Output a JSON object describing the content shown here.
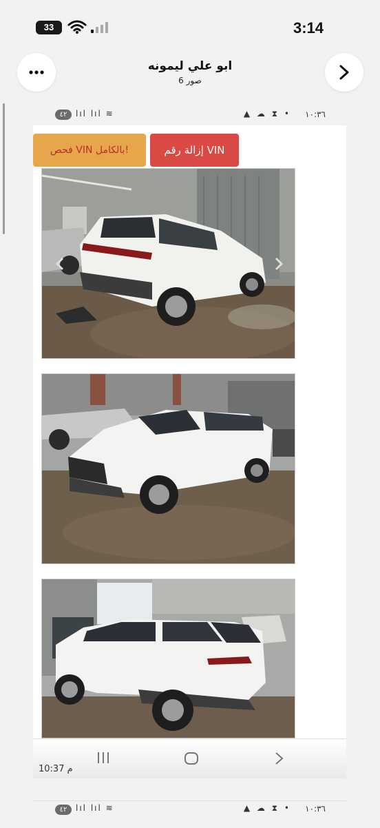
{
  "ios_status": {
    "time": "3:14",
    "battery": "33"
  },
  "header": {
    "title": "ابو علي ليمونه",
    "subtitle": "6 صور"
  },
  "embedded_status": {
    "time": "١٠:٣٦",
    "badge": "٤٢",
    "icons": "▲ ☁ ⧗ •",
    "signal": "lıl lıl ≋"
  },
  "buttons": {
    "vin_full_check": "فحص VIN بالكامل!",
    "vin_remove": "إزالة رقم VIN"
  },
  "photos": [
    {
      "alt": "white SUV rear three-quarter view"
    },
    {
      "alt": "white SUV front three-quarter view"
    },
    {
      "alt": "white SUV rear side view"
    }
  ],
  "bottom_nav": {
    "time": "10:37 م"
  },
  "next_status": {
    "time": "١٠:٣٦",
    "badge": "٤٢",
    "icons": "▲ ☁ ⧗ •",
    "signal": "lıl lıl ≋"
  }
}
